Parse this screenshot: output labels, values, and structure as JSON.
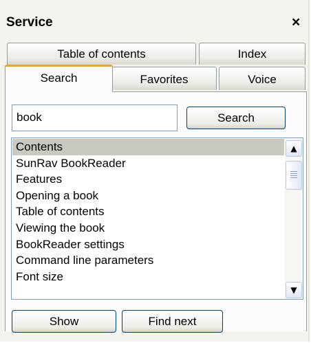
{
  "panel": {
    "title": "Service",
    "close_symbol": "×"
  },
  "tabs": {
    "row1": [
      {
        "label": "Table of contents"
      },
      {
        "label": "Index"
      }
    ],
    "row2": [
      {
        "label": "Search",
        "active": true
      },
      {
        "label": "Favorites"
      },
      {
        "label": "Voice"
      }
    ]
  },
  "search": {
    "query": "book",
    "button_label": "Search"
  },
  "results": {
    "items": [
      "Contents",
      "SunRav BookReader",
      "Features",
      "Opening a book",
      "Table of contents",
      "Viewing the book",
      "BookReader settings",
      "Command line parameters",
      "Font size"
    ],
    "selected_index": 0
  },
  "scrollbar": {
    "up_icon": "chevron-up-icon",
    "down_icon": "chevron-down-icon",
    "thumb_icon": "grip-lines-icon"
  },
  "actions": {
    "show_label": "Show",
    "find_next_label": "Find next"
  },
  "colors": {
    "tab_highlight": "#e5a53a",
    "selected_row": "#c9c8c1",
    "button_border": "#003c74"
  }
}
